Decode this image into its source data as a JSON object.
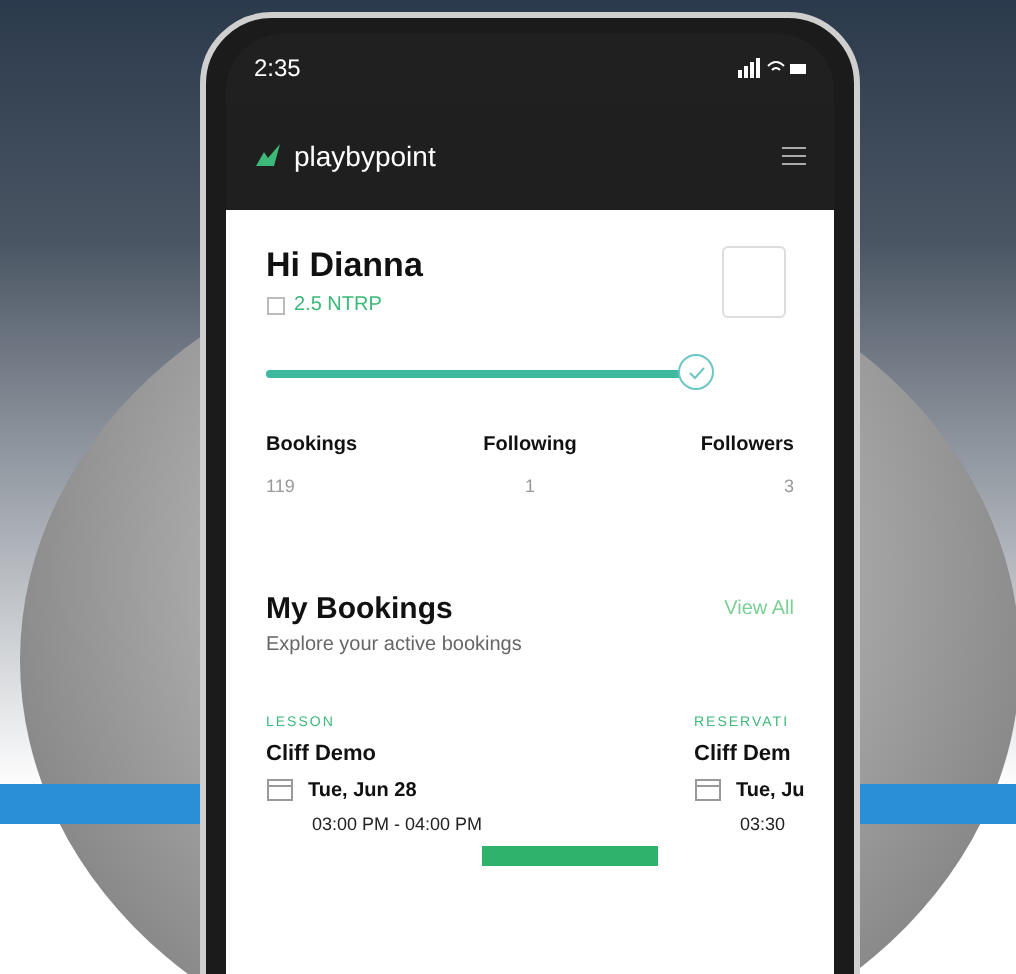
{
  "status_bar": {
    "time": "2:35"
  },
  "header": {
    "logo": "playbypoint"
  },
  "profile": {
    "greeting": "Hi Dianna",
    "rating": "2.5 NTRP",
    "progress": {
      "level": 1
    }
  },
  "stats": [
    {
      "label": "Bookings",
      "value": "119"
    },
    {
      "label": "Following",
      "value": "1"
    },
    {
      "label": "Followers",
      "value": "3"
    }
  ],
  "bookings": {
    "title": "My Bookings",
    "link": "View All",
    "subtitle": "Explore your active bookings",
    "cards": [
      {
        "type": "LESSON",
        "name": "Cliff Demo",
        "date": "Tue, Jun 28",
        "time": "03:00 PM - 04:00 PM"
      },
      {
        "type": "RESERVATI",
        "name": "Cliff Dem",
        "date": "Tue, Ju",
        "time": "03:30"
      }
    ]
  }
}
